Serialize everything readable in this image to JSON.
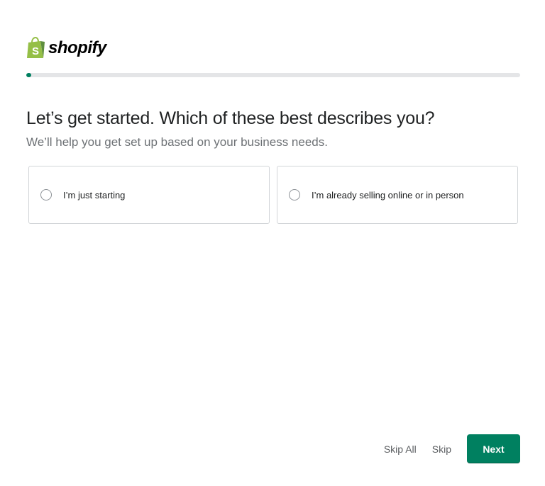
{
  "brand": {
    "name": "shopify",
    "logo_icon": "shopify-bag-icon",
    "logo_color": "#95bf47"
  },
  "progress": {
    "value_percent": 1,
    "fill_color": "#008060"
  },
  "question": {
    "title": "Let’s get started. Which of these best describes you?",
    "subtitle": "We’ll help you get set up based on your business needs."
  },
  "options": [
    {
      "label": "I’m just starting",
      "selected": false
    },
    {
      "label": "I’m already selling online or in person",
      "selected": false
    }
  ],
  "footer": {
    "skip_all_label": "Skip All",
    "skip_label": "Skip",
    "next_label": "Next"
  },
  "colors": {
    "primary": "#008060",
    "text": "#202223",
    "subdued": "#6d7175",
    "border": "#d2d5d8"
  }
}
